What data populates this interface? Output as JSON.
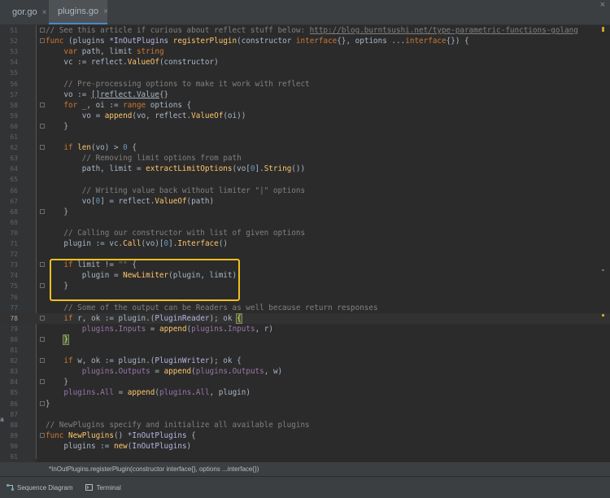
{
  "tabs": [
    {
      "label": "gor.go",
      "close": "×",
      "icon": "go-file-icon",
      "active": false
    },
    {
      "label": "plugins.go",
      "close": "×",
      "icon": "go-file-icon",
      "active": true
    }
  ],
  "corner_close": "×",
  "gutter_mark": "a",
  "code_lines": [
    {
      "n": "51",
      "fold": true,
      "segs": [
        [
          "cm",
          "// See this article if curious about reflect stuff below: "
        ],
        [
          "cm ul",
          "http://blog.burntsushi.net/type-parametric-functions-golang"
        ]
      ]
    },
    {
      "n": "52",
      "fold": true,
      "segs": [
        [
          "kw",
          "func "
        ],
        [
          "",
          "(plugins *"
        ],
        [
          "ty",
          "InOutPlugins"
        ],
        [
          "",
          " "
        ],
        [
          "fn",
          "registerPlugin"
        ],
        [
          "",
          "(constructor "
        ],
        [
          "kw",
          "interface"
        ],
        [
          "",
          "{}, options ..."
        ],
        [
          "kw",
          "interface"
        ],
        [
          "",
          "{}) {"
        ]
      ]
    },
    {
      "n": "53",
      "segs": [
        [
          "",
          "    "
        ],
        [
          "kw",
          "var "
        ],
        [
          "",
          "path, limit "
        ],
        [
          "kw",
          "string"
        ]
      ]
    },
    {
      "n": "54",
      "segs": [
        [
          "",
          "    vc := reflect."
        ],
        [
          "fn",
          "ValueOf"
        ],
        [
          "",
          "(constructor)"
        ]
      ]
    },
    {
      "n": "55",
      "segs": []
    },
    {
      "n": "56",
      "segs": [
        [
          "",
          "    "
        ],
        [
          "cm",
          "// Pre-processing options to make it work with reflect"
        ]
      ]
    },
    {
      "n": "57",
      "segs": [
        [
          "",
          "    vo := "
        ],
        [
          "ul",
          "[]reflect.Value"
        ],
        [
          "",
          "{}"
        ]
      ]
    },
    {
      "n": "58",
      "fold": true,
      "segs": [
        [
          "",
          "    "
        ],
        [
          "kw",
          "for "
        ],
        [
          "",
          "_, oi := "
        ],
        [
          "kw",
          "range "
        ],
        [
          "",
          "options {"
        ]
      ]
    },
    {
      "n": "59",
      "segs": [
        [
          "",
          "        vo = "
        ],
        [
          "fn",
          "append"
        ],
        [
          "",
          "(vo, reflect."
        ],
        [
          "fn",
          "ValueOf"
        ],
        [
          "",
          "(oi))"
        ]
      ]
    },
    {
      "n": "60",
      "fold": true,
      "segs": [
        [
          "",
          "    }"
        ]
      ]
    },
    {
      "n": "61",
      "segs": []
    },
    {
      "n": "62",
      "fold": true,
      "segs": [
        [
          "",
          "    "
        ],
        [
          "kw",
          "if "
        ],
        [
          "fn",
          "len"
        ],
        [
          "",
          "(vo) > "
        ],
        [
          "nu",
          "0"
        ],
        [
          "",
          " {"
        ]
      ]
    },
    {
      "n": "63",
      "segs": [
        [
          "",
          "        "
        ],
        [
          "cm",
          "// Removing limit options from path"
        ]
      ]
    },
    {
      "n": "64",
      "segs": [
        [
          "",
          "        path, limit = "
        ],
        [
          "fn",
          "extractLimitOptions"
        ],
        [
          "",
          "(vo["
        ],
        [
          "nu",
          "0"
        ],
        [
          "",
          "]."
        ],
        [
          "fn",
          "String"
        ],
        [
          "",
          "())"
        ]
      ]
    },
    {
      "n": "65",
      "segs": []
    },
    {
      "n": "66",
      "segs": [
        [
          "",
          "        "
        ],
        [
          "cm",
          "// Writing value back without limiter \"|\" options"
        ]
      ]
    },
    {
      "n": "67",
      "segs": [
        [
          "",
          "        vo["
        ],
        [
          "nu",
          "0"
        ],
        [
          "",
          "] = reflect."
        ],
        [
          "fn",
          "ValueOf"
        ],
        [
          "",
          "(path)"
        ]
      ]
    },
    {
      "n": "68",
      "fold": true,
      "segs": [
        [
          "",
          "    }"
        ]
      ]
    },
    {
      "n": "69",
      "segs": []
    },
    {
      "n": "70",
      "segs": [
        [
          "",
          "    "
        ],
        [
          "cm",
          "// Calling our constructor with list of given options"
        ]
      ]
    },
    {
      "n": "71",
      "segs": [
        [
          "",
          "    plugin := vc."
        ],
        [
          "fn",
          "Call"
        ],
        [
          "",
          "(vo)["
        ],
        [
          "nu",
          "0"
        ],
        [
          "",
          "]."
        ],
        [
          "fn",
          "Interface"
        ],
        [
          "",
          "()"
        ]
      ]
    },
    {
      "n": "72",
      "segs": []
    },
    {
      "n": "73",
      "fold": true,
      "segs": [
        [
          "",
          "    "
        ],
        [
          "kw",
          "if "
        ],
        [
          "",
          "limit != "
        ],
        [
          "st",
          "\"\""
        ],
        [
          "",
          " {"
        ]
      ]
    },
    {
      "n": "74",
      "segs": [
        [
          "",
          "        plugin = "
        ],
        [
          "fn",
          "NewLimiter"
        ],
        [
          "",
          "(plugin, limit)"
        ]
      ]
    },
    {
      "n": "75",
      "fold": true,
      "segs": [
        [
          "",
          "    }"
        ]
      ]
    },
    {
      "n": "76",
      "segs": []
    },
    {
      "n": "77",
      "segs": [
        [
          "",
          "    "
        ],
        [
          "cm",
          "// Some of the output can be Readers as well because return responses"
        ]
      ]
    },
    {
      "n": "78",
      "fold": true,
      "current": true,
      "segs": [
        [
          "",
          "    "
        ],
        [
          "kw",
          "if "
        ],
        [
          "",
          "r, ok := plugin.("
        ],
        [
          "ty",
          "PluginReader"
        ],
        [
          "",
          "); ok "
        ],
        [
          "br",
          "{"
        ]
      ]
    },
    {
      "n": "79",
      "segs": [
        [
          "",
          "        "
        ],
        [
          "field",
          "plugins"
        ],
        [
          "",
          "."
        ],
        [
          "field",
          "Inputs"
        ],
        [
          "",
          " = "
        ],
        [
          "fn",
          "append"
        ],
        [
          "",
          "("
        ],
        [
          "field",
          "plugins"
        ],
        [
          "",
          "."
        ],
        [
          "field",
          "Inputs"
        ],
        [
          "",
          ", r)"
        ]
      ]
    },
    {
      "n": "80",
      "fold": true,
      "segs": [
        [
          "",
          "    "
        ],
        [
          "br",
          "}"
        ]
      ]
    },
    {
      "n": "81",
      "segs": []
    },
    {
      "n": "82",
      "fold": true,
      "segs": [
        [
          "",
          "    "
        ],
        [
          "kw",
          "if "
        ],
        [
          "",
          "w, ok := plugin.("
        ],
        [
          "ty",
          "PluginWriter"
        ],
        [
          "",
          "); ok {"
        ]
      ]
    },
    {
      "n": "83",
      "segs": [
        [
          "",
          "        "
        ],
        [
          "field",
          "plugins"
        ],
        [
          "",
          "."
        ],
        [
          "field",
          "Outputs"
        ],
        [
          "",
          " = "
        ],
        [
          "fn",
          "append"
        ],
        [
          "",
          "("
        ],
        [
          "field",
          "plugins"
        ],
        [
          "",
          "."
        ],
        [
          "field",
          "Outputs"
        ],
        [
          "",
          ", w)"
        ]
      ]
    },
    {
      "n": "84",
      "fold": true,
      "segs": [
        [
          "",
          "    }"
        ]
      ]
    },
    {
      "n": "85",
      "segs": [
        [
          "",
          "    "
        ],
        [
          "field",
          "plugins"
        ],
        [
          "",
          "."
        ],
        [
          "field",
          "All"
        ],
        [
          "",
          " = "
        ],
        [
          "fn",
          "append"
        ],
        [
          "",
          "("
        ],
        [
          "field",
          "plugins"
        ],
        [
          "",
          "."
        ],
        [
          "field",
          "All"
        ],
        [
          "",
          ", plugin)"
        ]
      ]
    },
    {
      "n": "86",
      "fold": true,
      "segs": [
        [
          "",
          "}"
        ]
      ]
    },
    {
      "n": "87",
      "segs": []
    },
    {
      "n": "88",
      "segs": [
        [
          "cm",
          "// NewPlugins specify and initialize all available plugins"
        ]
      ]
    },
    {
      "n": "89",
      "fold": true,
      "segs": [
        [
          "kw",
          "func "
        ],
        [
          "fn",
          "NewPlugins"
        ],
        [
          "",
          "() *"
        ],
        [
          "ty",
          "InOutPlugins"
        ],
        [
          "",
          " {"
        ]
      ]
    },
    {
      "n": "90",
      "segs": [
        [
          "",
          "    plugins := "
        ],
        [
          "fn",
          "new"
        ],
        [
          "",
          "("
        ],
        [
          "ty",
          "InOutPlugins"
        ],
        [
          "",
          ")"
        ]
      ]
    },
    {
      "n": "91",
      "segs": []
    }
  ],
  "hint": "*InOutPlugins.registerPlugin(constructor interface{}, options ...interface{})",
  "tool_windows": [
    {
      "label": "Sequence Diagram",
      "icon": "sequence-diagram-icon"
    },
    {
      "label": "Terminal",
      "icon": "terminal-icon"
    }
  ],
  "colors": {
    "accent": "#4a88c7",
    "highlight_box": "#f0c020",
    "keyword": "#cc7832",
    "function": "#ffc66d",
    "comment": "#808080"
  }
}
